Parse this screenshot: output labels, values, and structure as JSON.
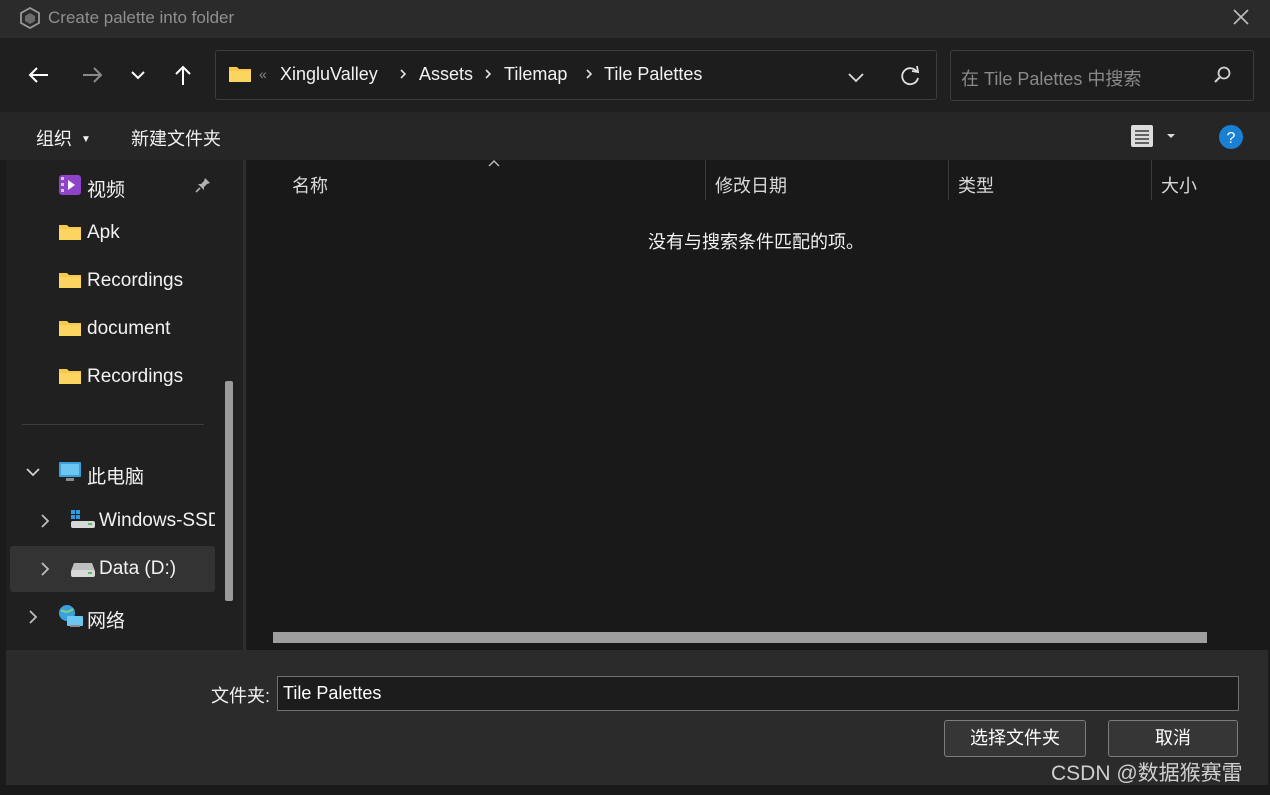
{
  "window": {
    "title": "Create palette into folder"
  },
  "breadcrumb": [
    "XingluValley",
    "Assets",
    "Tilemap",
    "Tile Palettes"
  ],
  "breadcrumb_overflow": "«",
  "search": {
    "placeholder": "在 Tile Palettes 中搜索"
  },
  "commandbar": {
    "organize": "组织",
    "new_folder": "新建文件夹"
  },
  "sidebar": {
    "quick": [
      {
        "label": "视频",
        "icon": "video-folder-icon",
        "pinned": true
      },
      {
        "label": "Apk",
        "icon": "folder-icon"
      },
      {
        "label": "Recordings",
        "icon": "folder-icon"
      },
      {
        "label": "document",
        "icon": "folder-icon"
      },
      {
        "label": "Recordings",
        "icon": "folder-icon"
      }
    ],
    "this_pc": "此电脑",
    "drives": [
      {
        "label": "Windows-SSD",
        "icon": "windows-drive-icon"
      },
      {
        "label": "Data (D:)",
        "icon": "drive-icon",
        "selected": true
      }
    ],
    "network": "网络"
  },
  "columns": {
    "name": "名称",
    "modified": "修改日期",
    "type": "类型",
    "size": "大小"
  },
  "empty_message": "没有与搜索条件匹配的项。",
  "folder_field": {
    "label": "文件夹:",
    "value": "Tile Palettes"
  },
  "buttons": {
    "select": "选择文件夹",
    "cancel": "取消"
  },
  "watermark": "CSDN @数据猴赛雷",
  "colors": {
    "folder": "#f7c84a",
    "help": "#1a80d4",
    "background": "#1b1b1b"
  }
}
